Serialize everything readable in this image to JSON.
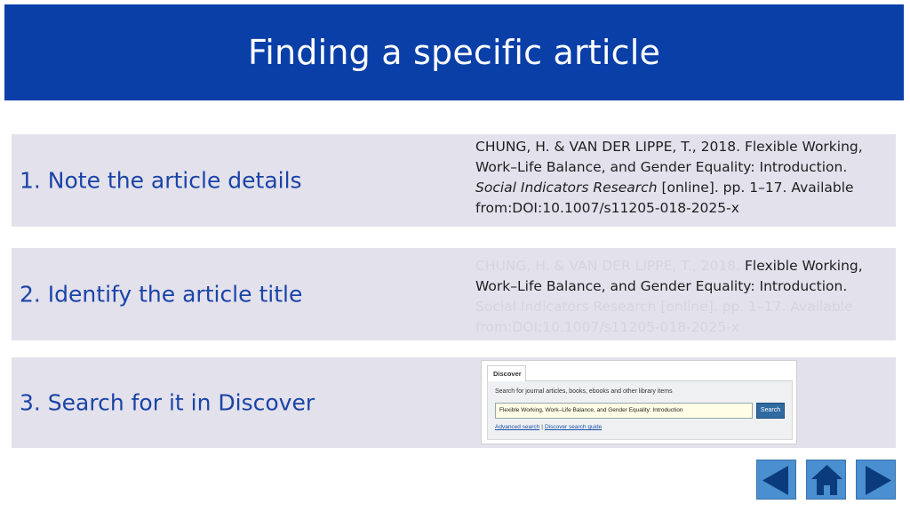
{
  "title": "Finding a specific article",
  "steps": [
    {
      "label": "1. Note the article details"
    },
    {
      "label": "2. Identify the article title"
    },
    {
      "label": "3. Search for it in Discover"
    }
  ],
  "reference": {
    "line1": "CHUNG, H. & VAN DER LIPPE, T., 2018. Flexible Working,",
    "line2": "Work–Life Balance, and Gender Equality: Introduction.",
    "journal": "Social Indicators Research",
    "line3_rest": " [online]. pp. 1–17. Available",
    "line4": "from:DOI:10.1007/s11205-018-2025-x"
  },
  "reference_faded": {
    "prefix": "CHUNG, H. & VAN DER LIPPE, T., 2018. ",
    "title_part1": "Flexible Working,",
    "title_part2": "Work–Life Balance, and Gender Equality: Introduction.",
    "rest_line3": "Social Indicators Research [online]. pp. 1–17. Available",
    "rest_line4": "from:DOI:10.1007/s11205-018-2025-x"
  },
  "discover": {
    "tab": "Discover",
    "prompt": "Search for journal articles, books, ebooks and other library items",
    "query": "Flexible Working, Work–Life Balance, and Gender Equality: Introduction",
    "search_button": "Search",
    "advanced_link": "Advanced search",
    "separator": "|",
    "guide_link": "Discover search guide"
  },
  "nav": {
    "prev_icon": "triangle-left",
    "home_icon": "house",
    "next_icon": "triangle-right",
    "color": "#4a8fd0"
  },
  "colors": {
    "header": "#0a3fa8",
    "row": "#e3e1ec",
    "step_text": "#1a44a6"
  }
}
